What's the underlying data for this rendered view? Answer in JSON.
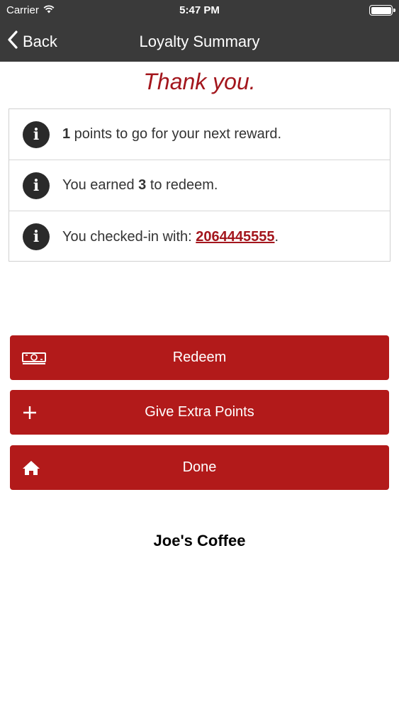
{
  "status_bar": {
    "carrier": "Carrier",
    "time": "5:47 PM"
  },
  "nav": {
    "back_label": "Back",
    "title": "Loyalty Summary"
  },
  "thanks_text": "Thank you.",
  "info_rows": {
    "points_to_go": {
      "number": "1",
      "text": " points to go for your next reward."
    },
    "earned": {
      "prefix": "You earned ",
      "number": "3",
      "suffix": " to redeem."
    },
    "checked_in": {
      "prefix": "You checked-in with: ",
      "phone": "2064445555",
      "suffix": "."
    }
  },
  "buttons": {
    "redeem": "Redeem",
    "give_extra_points": "Give Extra Points",
    "done": "Done"
  },
  "footer": {
    "business_name": "Joe's Coffee"
  },
  "colors": {
    "brand_red": "#b21a1a",
    "accent_red": "#a3161d",
    "nav_background": "#3a3a3a"
  },
  "icons": {
    "info": "info-icon",
    "money": "money-icon",
    "plus": "plus-icon",
    "home": "home-icon",
    "back": "chevron-left-icon",
    "wifi": "wifi-icon",
    "battery": "battery-icon"
  }
}
